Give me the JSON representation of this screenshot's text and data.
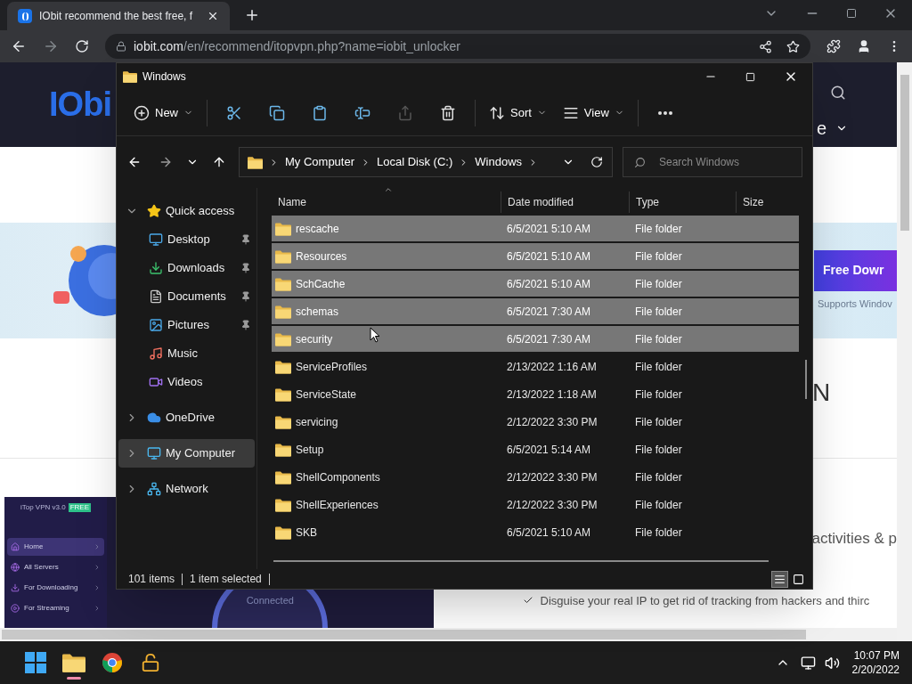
{
  "browser": {
    "tab": {
      "title": "IObit recommend the best free, f"
    },
    "address": {
      "host": "iobit.com",
      "path": "/en/recommend/itopvpn.php?name=iobit_unlocker"
    }
  },
  "webpage": {
    "logo": "IObi",
    "nav_fragment": "e",
    "download_button": "Free Dowr",
    "supports": "Supports Windov",
    "heading_fragment": "N",
    "vpn_app": {
      "title": "iTop VPN v3.0",
      "badge": "FREE",
      "status": "Connected",
      "menu": [
        {
          "label": "Home",
          "kind": "home",
          "selected": true
        },
        {
          "label": "All Servers",
          "kind": "globe",
          "selected": false
        },
        {
          "label": "For Downloading",
          "kind": "download",
          "selected": false
        },
        {
          "label": "For Streaming",
          "kind": "play",
          "selected": false
        }
      ]
    },
    "features_heading": "activities & p",
    "features": [
      "Disguise your real IP to get rid of tracking from hackers and thirc"
    ]
  },
  "explorer": {
    "title": "Windows",
    "toolbar": [
      {
        "kind": "new",
        "label": "New",
        "disabled": false
      },
      {
        "kind": "cut",
        "disabled": false
      },
      {
        "kind": "copy",
        "disabled": false
      },
      {
        "kind": "paste",
        "disabled": false
      },
      {
        "kind": "rename",
        "disabled": false
      },
      {
        "kind": "share",
        "disabled": true
      },
      {
        "kind": "delete",
        "disabled": false
      },
      {
        "kind": "sort",
        "label": "Sort",
        "disabled": false
      },
      {
        "kind": "view",
        "label": "View",
        "disabled": false
      },
      {
        "kind": "more",
        "disabled": false
      }
    ],
    "breadcrumb": [
      "My Computer",
      "Local Disk (C:)",
      "Windows"
    ],
    "search": {
      "placeholder": "Search Windows"
    },
    "nav": [
      {
        "label": "Quick access",
        "kind": "star",
        "expanded": true,
        "selected": false,
        "children": [
          {
            "label": "Desktop",
            "kind": "desktop",
            "pinned": true,
            "selected": false
          },
          {
            "label": "Downloads",
            "kind": "download",
            "pinned": true,
            "selected": false
          },
          {
            "label": "Documents",
            "kind": "document",
            "pinned": true,
            "selected": false
          },
          {
            "label": "Pictures",
            "kind": "picture",
            "pinned": true,
            "selected": false
          },
          {
            "label": "Music",
            "kind": "music",
            "pinned": false,
            "selected": false
          },
          {
            "label": "Videos",
            "kind": "video",
            "pinned": false,
            "selected": false
          }
        ]
      },
      {
        "label": "OneDrive",
        "kind": "cloud",
        "expanded": false,
        "selected": false
      },
      {
        "label": "My Computer",
        "kind": "computer",
        "expanded": false,
        "selected": true
      },
      {
        "label": "Network",
        "kind": "network",
        "expanded": false,
        "selected": false
      }
    ],
    "columns": [
      "Name",
      "Date modified",
      "Type",
      "Size"
    ],
    "rows": [
      {
        "name": "rescache",
        "date": "6/5/2021 5:10 AM",
        "type": "File folder",
        "selected": true
      },
      {
        "name": "Resources",
        "date": "6/5/2021 5:10 AM",
        "type": "File folder",
        "selected": true
      },
      {
        "name": "SchCache",
        "date": "6/5/2021 5:10 AM",
        "type": "File folder",
        "selected": true
      },
      {
        "name": "schemas",
        "date": "6/5/2021 7:30 AM",
        "type": "File folder",
        "selected": true
      },
      {
        "name": "security",
        "date": "6/5/2021 7:30 AM",
        "type": "File folder",
        "selected": true
      },
      {
        "name": "ServiceProfiles",
        "date": "2/13/2022 1:16 AM",
        "type": "File folder",
        "selected": false
      },
      {
        "name": "ServiceState",
        "date": "2/13/2022 1:18 AM",
        "type": "File folder",
        "selected": false
      },
      {
        "name": "servicing",
        "date": "2/12/2022 3:30 PM",
        "type": "File folder",
        "selected": false
      },
      {
        "name": "Setup",
        "date": "6/5/2021 5:14 AM",
        "type": "File folder",
        "selected": false
      },
      {
        "name": "ShellComponents",
        "date": "2/12/2022 3:30 PM",
        "type": "File folder",
        "selected": false
      },
      {
        "name": "ShellExperiences",
        "date": "2/12/2022 3:30 PM",
        "type": "File folder",
        "selected": false
      },
      {
        "name": "SKB",
        "date": "6/5/2021 5:10 AM",
        "type": "File folder",
        "selected": false
      }
    ],
    "status": {
      "count": "101 items",
      "selection": "1 item selected"
    },
    "view_modes": [
      {
        "kind": "details",
        "selected": true
      },
      {
        "kind": "tiles",
        "selected": false
      }
    ]
  },
  "taskbar": {
    "apps": [
      {
        "kind": "start",
        "active": false
      },
      {
        "kind": "explorer",
        "active": true
      },
      {
        "kind": "chrome",
        "active": false
      },
      {
        "kind": "unlocker",
        "active": false
      }
    ],
    "time": "10:07 PM",
    "date": "2/20/2022"
  }
}
